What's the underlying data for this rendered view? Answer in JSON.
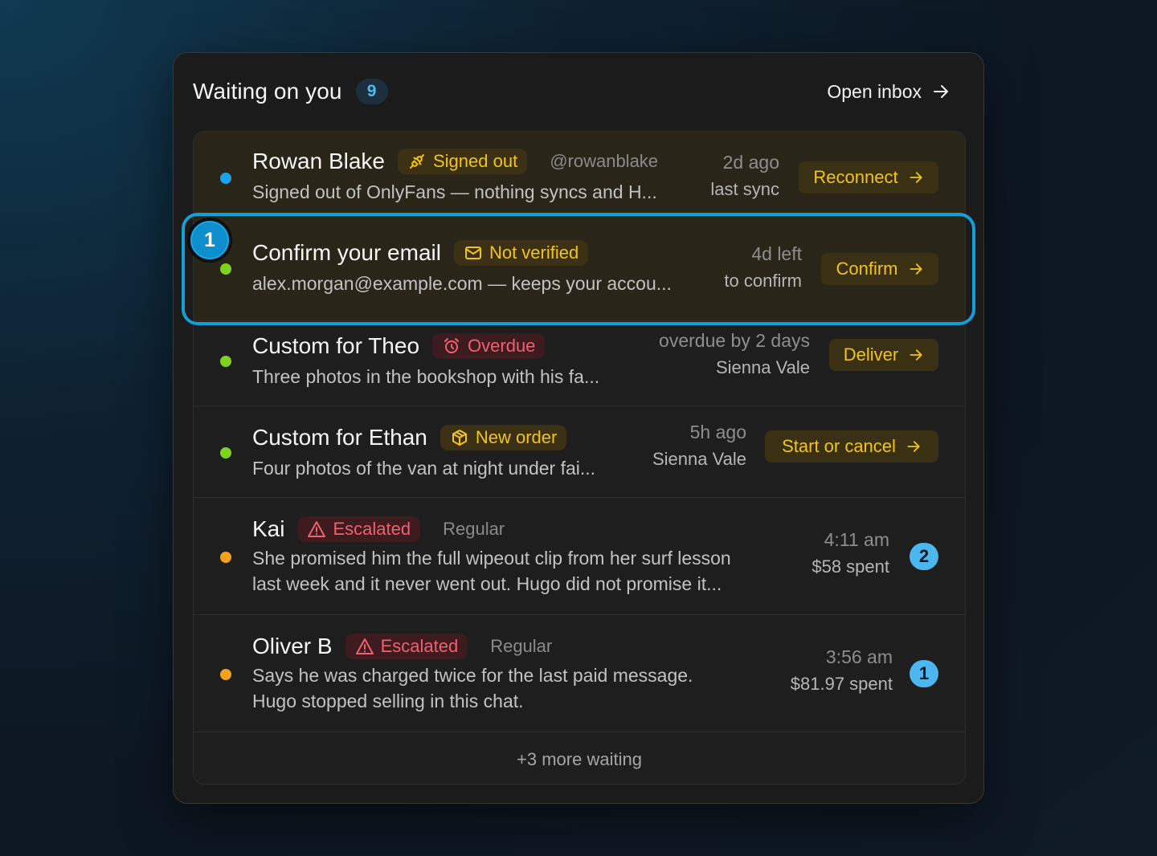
{
  "header": {
    "title": "Waiting on you",
    "count": "9",
    "open_inbox_label": "Open inbox"
  },
  "colors": {
    "accent_blue": "#4cb7ee",
    "accent_yellow": "#f2c318",
    "danger_red": "#f06070",
    "dot_blue": "#1ba3ec",
    "dot_green": "#7ed321",
    "dot_orange": "#f5a11c"
  },
  "rows": [
    {
      "name": "Rowan Blake",
      "tag": "Signed out",
      "tag_icon": "unplug-icon",
      "meta": "@rowanblake",
      "subtitle": "Signed out of OnlyFans — nothing syncs and H...",
      "time": "2d ago",
      "detail": "last sync",
      "action": "Reconnect"
    },
    {
      "name": "Confirm your email",
      "tag": "Not verified",
      "tag_icon": "mail-icon",
      "subtitle": "alex.morgan@example.com — keeps your accou...",
      "time": "4d left",
      "detail": "to confirm",
      "action": "Confirm"
    },
    {
      "name": "Custom for Theo",
      "tag": "Overdue",
      "tag_icon": "alarm-clock-icon",
      "subtitle": "Three photos in the bookshop with his fa...",
      "time": "overdue by 2 days",
      "detail": "Sienna Vale",
      "action": "Deliver"
    },
    {
      "name": "Custom for Ethan",
      "tag": "New order",
      "tag_icon": "package-icon",
      "subtitle": "Four photos of the van at night under fai...",
      "time": "5h ago",
      "detail": "Sienna Vale",
      "action": "Start or cancel"
    },
    {
      "name": "Kai",
      "tag": "Escalated",
      "tag_icon": "warning-triangle-icon",
      "meta": "Regular",
      "subtitle_line1": "She promised him the full wipeout clip from her surf lesson",
      "subtitle_line2": "last week and it never went out. Hugo did not promise it...",
      "time": "4:11 am",
      "detail": "$58 spent",
      "unread": "2"
    },
    {
      "name": "Oliver B",
      "tag": "Escalated",
      "tag_icon": "warning-triangle-icon",
      "meta": "Regular",
      "subtitle_line1": "Says he was charged twice for the last paid message.",
      "subtitle_line2": "Hugo stopped selling in this chat.",
      "time": "3:56 am",
      "detail": "$81.97 spent",
      "unread": "1"
    }
  ],
  "footer": {
    "more_label": "+3 more waiting"
  },
  "annotation": {
    "step": "1"
  }
}
